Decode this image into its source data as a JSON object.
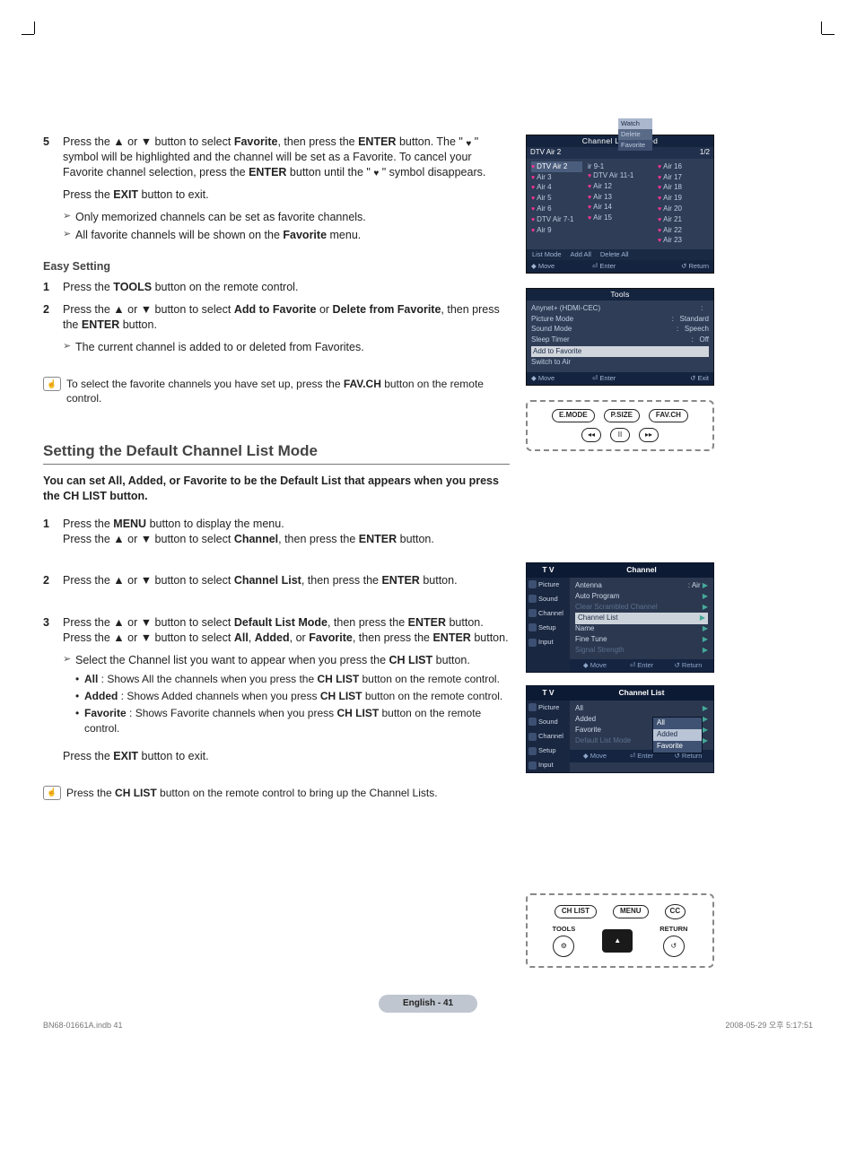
{
  "steps": {
    "s5": {
      "num": "5",
      "line1a": "Press the ▲ or ▼ button to select ",
      "line1b": "Favorite",
      "line1c": ", then press the ",
      "line1d": "ENTER",
      "line1e": " button.  The \" ",
      "heart1": "♥",
      "line1f": " \" symbol will be highlighted and the channel will be set as a Favorite. To cancel your Favorite channel selection, press the ",
      "line1g": "ENTER",
      "line1h": " button until the \" ",
      "heart2": "♥",
      "line1i": " \" symbol disappears.",
      "exit1": "Press the ",
      "exit2": "EXIT",
      "exit3": " button to exit.",
      "note1": "Only memorized channels can be set as favorite channels.",
      "note2a": "All favorite channels will be shown on the ",
      "note2b": "Favorite",
      "note2c": " menu."
    },
    "easy_label": "Easy Setting",
    "e1": {
      "num": "1",
      "a": "Press the ",
      "b": "TOOLS",
      "c": " button on the remote control."
    },
    "e2": {
      "num": "2",
      "a": "Press the ▲ or ▼ button to select ",
      "b": "Add to Favorite",
      "c": " or ",
      "d": "Delete from Favorite",
      "e": ", then press the ",
      "f": "ENTER",
      "g": " button."
    },
    "e_note": "The current channel is added to or deleted from Favorites.",
    "tip1a": "To select the favorite channels you have set up, press the ",
    "tip1b": "FAV.CH",
    "tip1c": " button on the remote control."
  },
  "section2": {
    "title": "Setting the Default Channel List Mode",
    "desc": "You can set All, Added, or Favorite to be the Default List that appears when you press the CH LIST button.",
    "s1": {
      "num": "1",
      "a": "Press the ",
      "b": "MENU",
      "c": " button to display the menu.",
      "d": "Press the ▲ or ▼ button to select ",
      "e": "Channel",
      "f": ", then press the ",
      "g": "ENTER",
      "h": " button."
    },
    "s2": {
      "num": "2",
      "a": "Press the ▲ or ▼ button to select ",
      "b": "Channel List",
      "c": ", then press the ",
      "d": "ENTER",
      "e": " button."
    },
    "s3": {
      "num": "3",
      "a": "Press the ▲ or ▼ button to select ",
      "b": "Default List Mode",
      "c": ", then press the ",
      "d": "ENTER",
      "e": " button.",
      "f": "Press the ▲ or ▼ button to select ",
      "g": "All",
      "h": ", ",
      "i": "Added",
      "j": ", or ",
      "k": "Favorite",
      "l": ", then press the ",
      "m": "ENTER",
      "n": " button."
    },
    "s3note": {
      "a": "Select the Channel list you want to appear when you press the ",
      "b": "CH LIST",
      "c": " button."
    },
    "b_all": {
      "a": "All",
      "b": " : Shows All the channels when you press the ",
      "c": "CH LIST",
      "d": " button on the remote control."
    },
    "b_add": {
      "a": "Added",
      "b": " : Shows Added channels when you press ",
      "c": "CH LIST",
      "d": " button on the remote control."
    },
    "b_fav": {
      "a": "Favorite",
      "b": " : Shows Favorite channels when you press ",
      "c": "CH LIST",
      "d": " button on the remote control."
    },
    "exit1": "Press the ",
    "exit2": "EXIT",
    "exit3": " button to exit.",
    "tip2a": "Press the ",
    "tip2b": "CH LIST",
    "tip2c": " button on the remote control to bring up the Channel Lists."
  },
  "scr_channels": {
    "title": "Channel List / Added",
    "sub_left": "DTV Air 2",
    "sub_right": "1/2",
    "col1": [
      "DTV Air 2",
      "Air 3",
      "Air 4",
      "Air 5",
      "Air 6",
      "DTV Air 7-1",
      "Air 9"
    ],
    "col1_menu": [
      "Watch",
      "Delete",
      "Favorite"
    ],
    "col2label": "ir 9-1",
    "col2": [
      "DTV Air 11-1",
      "Air 12",
      "Air 13",
      "Air 14",
      "Air 15"
    ],
    "col3": [
      "Air 16",
      "Air 17",
      "Air 18",
      "Air 19",
      "Air 20",
      "Air 21",
      "Air 22",
      "Air 23"
    ],
    "foot1": "List Mode",
    "foot2": "Add All",
    "foot3": "Delete All",
    "foot4a": "Move",
    "foot4b": "Enter",
    "foot4c": "Return"
  },
  "scr_tools": {
    "title": "Tools",
    "rows": [
      {
        "l": "Anynet+ (HDMI-CEC)",
        "r": ""
      },
      {
        "l": "Picture Mode",
        "r": "Standard"
      },
      {
        "l": "Sound Mode",
        "r": "Speech"
      },
      {
        "l": "Sleep Timer",
        "r": "Off"
      }
    ],
    "sel": "Add to Favorite",
    "after": "Switch to Air",
    "foot": {
      "a": "Move",
      "b": "Enter",
      "c": "Exit"
    }
  },
  "remote1": {
    "b1": "E.MODE",
    "b2": "P.SIZE",
    "b3": "FAV.CH",
    "r1": "◂◂",
    "r2": "II",
    "r3": "▸▸"
  },
  "tv1": {
    "side_hdr": "T V",
    "side": [
      "Picture",
      "Sound",
      "Channel",
      "Setup",
      "Input"
    ],
    "main_hdr": "Channel",
    "rows": [
      {
        "l": "Antenna",
        "r": ": Air",
        "sel": false,
        "fade": false
      },
      {
        "l": "Auto Program",
        "r": "",
        "sel": false,
        "fade": false
      },
      {
        "l": "Clear Scrambled Channel",
        "r": "",
        "sel": false,
        "fade": true
      },
      {
        "l": "Channel List",
        "r": "",
        "sel": true,
        "fade": false
      },
      {
        "l": "Name",
        "r": "",
        "sel": false,
        "fade": false
      },
      {
        "l": "Fine Tune",
        "r": "",
        "sel": false,
        "fade": false
      },
      {
        "l": "Signal Strength",
        "r": "",
        "sel": false,
        "fade": true
      }
    ],
    "foot": {
      "a": "Move",
      "b": "Enter",
      "c": "Return"
    }
  },
  "tv2": {
    "side_hdr": "T V",
    "side": [
      "Picture",
      "Sound",
      "Channel",
      "Setup",
      "Input"
    ],
    "main_hdr": "Channel List",
    "rows": [
      {
        "l": "All",
        "sel": false,
        "fade": false
      },
      {
        "l": "Added",
        "sel": false,
        "fade": false
      },
      {
        "l": "Favorite",
        "sel": false,
        "fade": false
      },
      {
        "l": "Default List Mode",
        "sel": false,
        "fade": true
      }
    ],
    "dd": [
      "All",
      "Added",
      "Favorite"
    ],
    "foot": {
      "a": "Move",
      "b": "Enter",
      "c": "Return"
    }
  },
  "remote2": {
    "b1": "CH LIST",
    "b2": "MENU",
    "b3": "CC",
    "l1": "TOOLS",
    "l2": "RETURN",
    "ret": "↺"
  },
  "footer_pill": "English - 41",
  "docfoot": {
    "l": "BN68-01661A.indb   41",
    "r": "2008-05-29   오후 5:17:51"
  }
}
